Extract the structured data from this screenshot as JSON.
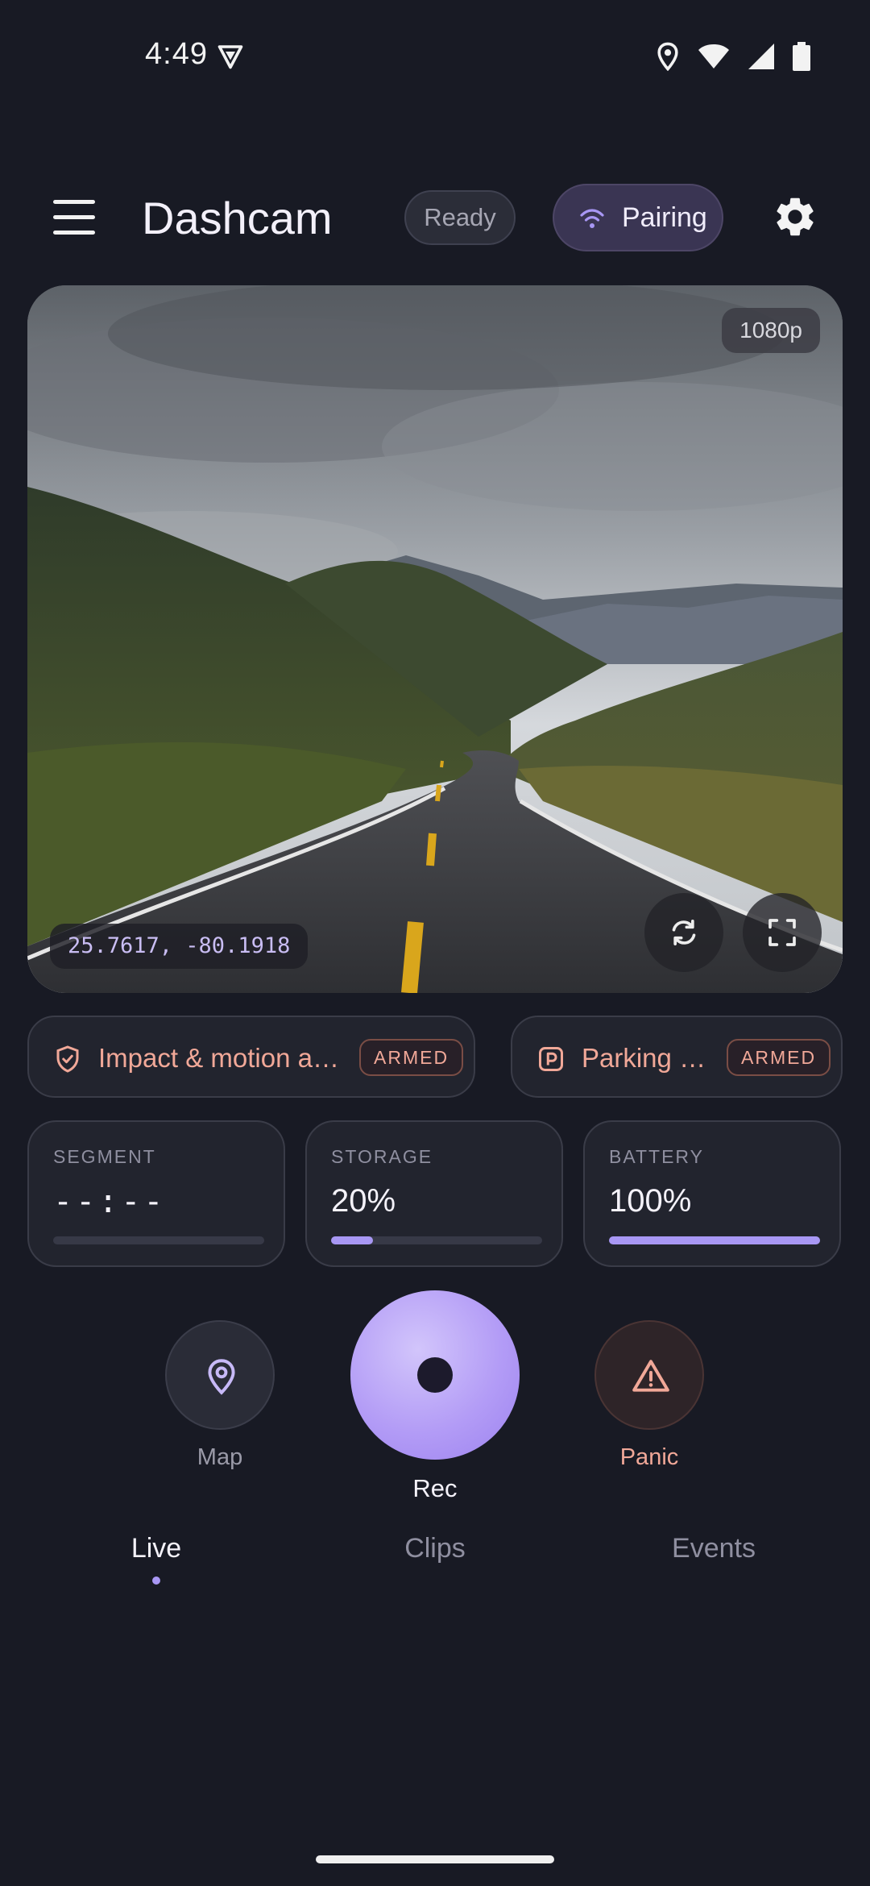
{
  "status_bar": {
    "time": "4:49"
  },
  "app_bar": {
    "title": "Dashcam",
    "ready_chip": "Ready",
    "pairing_chip": "Pairing"
  },
  "preview": {
    "resolution": "1080p",
    "coordinates": "25.7617, -80.1918"
  },
  "alerts": [
    {
      "label": "Impact & motion ar...",
      "badge": "ARMED",
      "icon": "shield-icon"
    },
    {
      "label": "Parking mo...",
      "badge": "ARMED",
      "icon": "parking-icon"
    }
  ],
  "stats": [
    {
      "caption": "SEGMENT",
      "value": "--:--",
      "progress": 0
    },
    {
      "caption": "STORAGE",
      "value": "20%",
      "progress": 0.2
    },
    {
      "caption": "BATTERY",
      "value": "100%",
      "progress": 1.0
    }
  ],
  "actions": {
    "map_label": "Map",
    "rec_label": "Rec",
    "panic_label": "Panic"
  },
  "tabs": [
    {
      "label": "Live",
      "active": true
    },
    {
      "label": "Clips",
      "active": false
    },
    {
      "label": "Events",
      "active": false
    }
  ],
  "colors": {
    "background": "#181a24",
    "accent": "#a897f4",
    "alert": "#f1a898"
  }
}
